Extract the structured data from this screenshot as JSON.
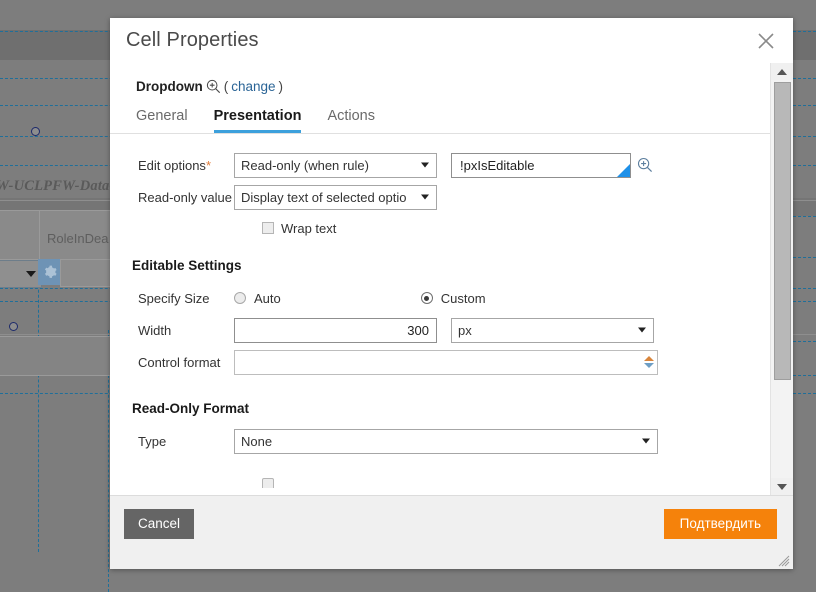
{
  "backdrop": {
    "rule_label": "W-UCLPFW-Data-P",
    "cell_label": "RoleInDea",
    "gear_icon": "gear-icon"
  },
  "modal": {
    "title": "Cell Properties",
    "close_icon": "close-icon",
    "object": {
      "name": "Dropdown",
      "zoom_icon": "magnifier-plus-icon",
      "open_paren": "(",
      "change_link": "change",
      "close_paren": ")"
    },
    "tabs": [
      {
        "label": "General",
        "active": false
      },
      {
        "label": "Presentation",
        "active": true
      },
      {
        "label": "Actions",
        "active": false
      }
    ],
    "fields": {
      "edit_options": {
        "label": "Edit options",
        "required_mark": "*",
        "value": "Read-only (when rule)",
        "rule_value": "!pxIsEditable",
        "rule_placeholder": "",
        "rule_zoom_icon": "magnifier-plus-icon"
      },
      "read_only_value": {
        "label": "Read-only value",
        "value": "Display text of selected optio"
      },
      "wrap_text": {
        "label": "Wrap text",
        "checked": false
      }
    },
    "editable_settings": {
      "section_title": "Editable Settings",
      "specify_size": {
        "label": "Specify Size",
        "options": [
          {
            "label": "Auto",
            "selected": false
          },
          {
            "label": "Custom",
            "selected": true
          }
        ]
      },
      "width": {
        "label": "Width",
        "value": "300",
        "unit": "px"
      },
      "control_format": {
        "label": "Control format",
        "value": "",
        "spinner_up_icon": "spinner-up-icon",
        "spinner_down_icon": "spinner-down-icon"
      }
    },
    "read_only_format": {
      "section_title": "Read-Only Format",
      "type": {
        "label": "Type",
        "value": "None"
      }
    },
    "scrollbar": {
      "up_icon": "scroll-up-icon",
      "down_icon": "scroll-down-icon",
      "thumb": "scroll-thumb"
    },
    "footer": {
      "cancel_label": "Cancel",
      "confirm_label": "Подтвердить",
      "resize_grip": "resize-grip-icon"
    }
  },
  "colors": {
    "accent_tab": "#3ca0dc",
    "confirm_button": "#f5820b",
    "cancel_button": "#656565",
    "link": "#2a6496",
    "required": "#e07b39",
    "rule_corner": "#1e90e8",
    "guide": "#1f6f9a"
  }
}
